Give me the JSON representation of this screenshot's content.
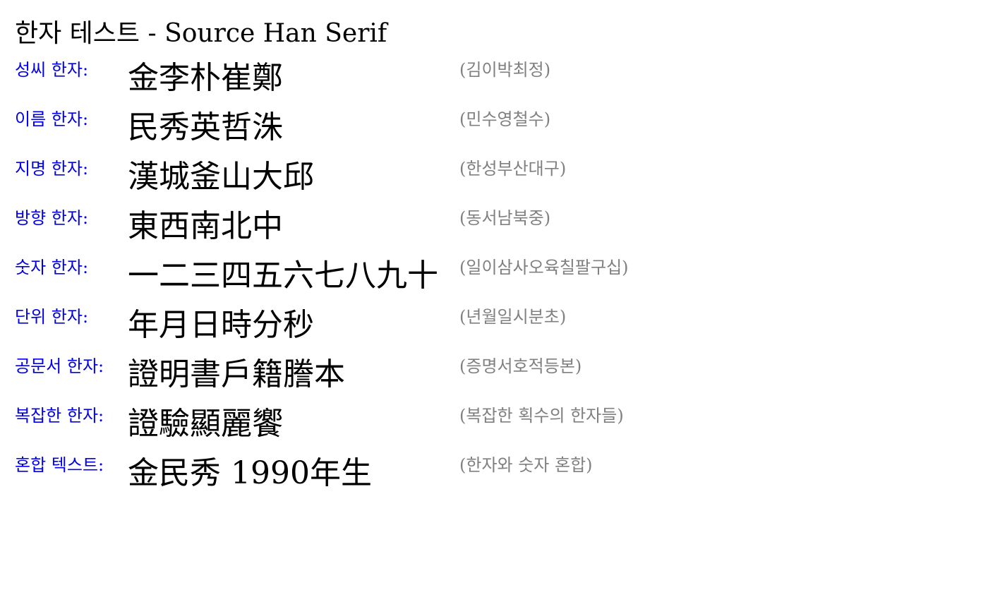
{
  "title": "한자 테스트 - Source Han Serif",
  "colors": {
    "label": "#0000ee",
    "hanja": "#000000",
    "reading": "#808080"
  },
  "rows": [
    {
      "label": "성씨 한자:",
      "hanja": "金李朴崔鄭",
      "reading": "(김이박최정)"
    },
    {
      "label": "이름 한자:",
      "hanja": "民秀英哲洙",
      "reading": "(민수영철수)"
    },
    {
      "label": "지명 한자:",
      "hanja": "漢城釜山大邱",
      "reading": "(한성부산대구)"
    },
    {
      "label": "방향 한자:",
      "hanja": "東西南北中",
      "reading": "(동서남북중)"
    },
    {
      "label": "숫자 한자:",
      "hanja": "一二三四五六七八九十",
      "reading": "(일이삼사오육칠팔구십)"
    },
    {
      "label": "단위 한자:",
      "hanja": "年月日時分秒",
      "reading": "(년월일시분초)"
    },
    {
      "label": "공문서 한자:",
      "hanja": "證明書戶籍謄本",
      "reading": "(증명서호적등본)"
    },
    {
      "label": "복잡한 한자:",
      "hanja": "證驗顯麗饗",
      "reading": "(복잡한 획수의 한자들)"
    },
    {
      "label": "혼합 텍스트:",
      "hanja": "金民秀 1990年生",
      "reading": "(한자와 숫자 혼합)"
    }
  ]
}
